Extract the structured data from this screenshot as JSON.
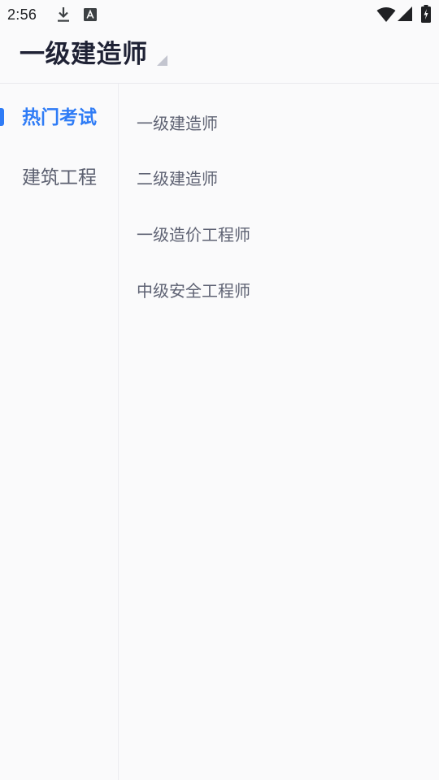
{
  "status_bar": {
    "time": "2:56",
    "icons": [
      "download-icon",
      "text-a-icon",
      "wifi-icon",
      "signal-icon",
      "battery-charging-icon"
    ]
  },
  "header": {
    "title": "一级建造师",
    "dropdown_icon": "dropdown-triangle-icon"
  },
  "sidebar": {
    "items": [
      {
        "label": "热门考试",
        "active": true
      },
      {
        "label": "建筑工程",
        "active": false
      }
    ]
  },
  "content": {
    "items": [
      {
        "label": "一级建造师"
      },
      {
        "label": "二级建造师"
      },
      {
        "label": "一级造价工程师"
      },
      {
        "label": "中级安全工程师"
      }
    ]
  },
  "colors": {
    "accent": "#2f7cf6",
    "background": "#fafafb",
    "title": "#1f2235",
    "text_secondary": "#5e6273"
  }
}
